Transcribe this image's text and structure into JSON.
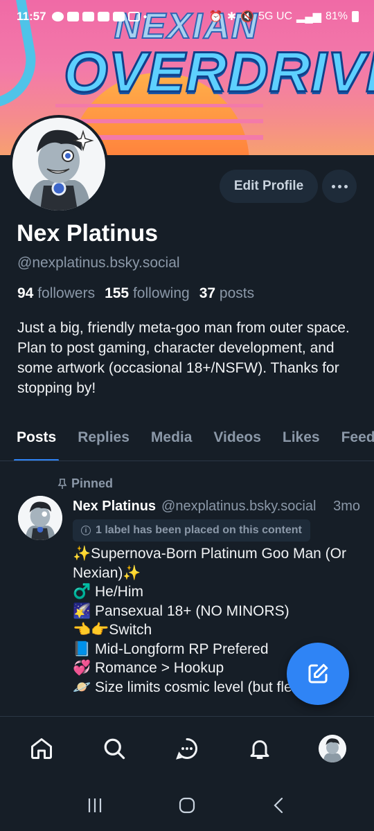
{
  "status_bar": {
    "time": "11:57",
    "network": "5G UC",
    "battery": "81%"
  },
  "banner": {
    "title_top": "NEXIAN",
    "title_main": "OVERDRIVE"
  },
  "profile": {
    "display_name": "Nex Platinus",
    "handle": "@nexplatinus.bsky.social",
    "followers_count": "94",
    "followers_label": "followers",
    "following_count": "155",
    "following_label": "following",
    "posts_count": "37",
    "posts_label": "posts",
    "bio": "Just a big, friendly meta-goo man from outer space. Plan to post gaming, character development, and some artwork (occasional 18+/NSFW). Thanks for stopping by!",
    "edit_label": "Edit Profile"
  },
  "tabs": [
    {
      "label": "Posts",
      "active": true
    },
    {
      "label": "Replies"
    },
    {
      "label": "Media"
    },
    {
      "label": "Videos"
    },
    {
      "label": "Likes"
    },
    {
      "label": "Feeds"
    }
  ],
  "post": {
    "pinned_label": "Pinned",
    "author_name": "Nex Platinus",
    "author_handle": "@nexplatinus.bsky.social",
    "time": "3mo",
    "label_notice": "1 label has been placed on this content",
    "lines": [
      "✨Supernova-Born Platinum Goo Man (Or Nexian)✨",
      "♂️ He/Him",
      "🌠 Pansexual 18+ (NO MINORS)",
      "👈👉Switch",
      "📘 Mid-Longform RP Prefered",
      "💞 Romance > Hookup",
      "🪐 Size limits cosmic level (but flexible)"
    ]
  },
  "colors": {
    "background": "#161e27",
    "accent": "#2f84f5",
    "muted": "#8b98a8",
    "chip": "#1e2b39"
  },
  "icons": [
    "home-icon",
    "search-icon",
    "chat-icon",
    "bell-icon",
    "compose-icon",
    "pin-icon",
    "info-icon",
    "more-icon"
  ]
}
